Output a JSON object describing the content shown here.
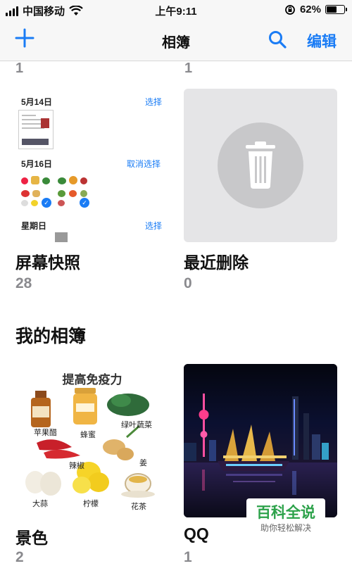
{
  "status_bar": {
    "carrier": "中国移动",
    "time": "上午9:11",
    "battery_text": "62%",
    "battery_level": 0.62
  },
  "nav": {
    "title": "相簿",
    "edit_label": "编辑",
    "add_icon": "plus-icon",
    "search_icon": "search-icon"
  },
  "previous_row_counts": [
    "1",
    "1"
  ],
  "albums_top": [
    {
      "title": "屏幕快照",
      "count": "28",
      "preview": {
        "groups": [
          {
            "date": "5月14日",
            "action": "选择"
          },
          {
            "date": "5月16日",
            "action": "取消选择"
          },
          {
            "date": "星期日",
            "action": "选择"
          }
        ]
      }
    },
    {
      "title": "最近删除",
      "count": "0",
      "icon": "trash-icon"
    }
  ],
  "section_title": "我的相簿",
  "albums_mine": [
    {
      "title": "景色",
      "count": "2",
      "poster": {
        "title": "提高免疫力",
        "items": [
          "苹果醋",
          "蜂蜜",
          "绿叶蔬菜",
          "辣椒",
          "姜",
          "大蒜",
          "柠檬",
          "花茶"
        ]
      }
    },
    {
      "title": "QQ",
      "count": "1"
    }
  ],
  "watermark": {
    "title": "百科全说",
    "subtitle": "助你轻松解决"
  },
  "colors": {
    "accent": "#1a7cf5",
    "secondary_text": "#8a8a8e",
    "watermark_green": "#2ca24a"
  }
}
